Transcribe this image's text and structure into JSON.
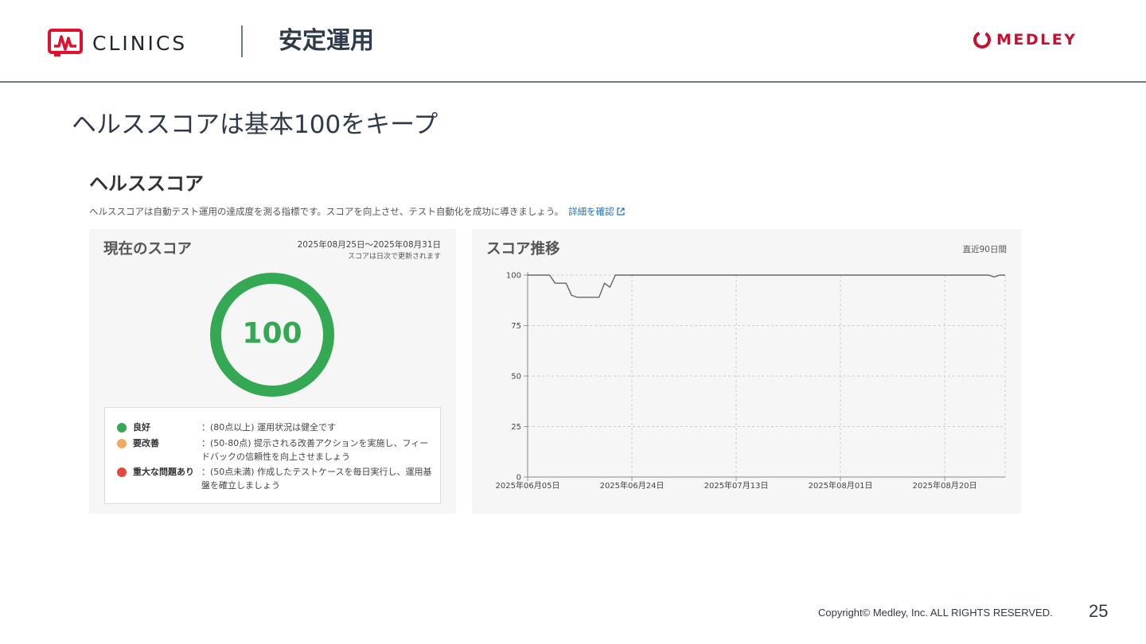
{
  "header": {
    "brand": "CLINICS",
    "section_title": "安定運用",
    "company": "MEDLEY",
    "brand_color": "#e0102e",
    "company_color": "#c8102e"
  },
  "slide": {
    "heading": "ヘルススコアは基本100をキープ"
  },
  "health": {
    "title": "ヘルススコア",
    "description": "ヘルススコアは自動テスト運用の達成度を測る指標です。スコアを向上させ、テスト自動化を成功に導きましょう。",
    "link_label": "詳細を確認",
    "link_icon": "external-link-icon",
    "current": {
      "title": "現在のスコア",
      "period": "2025年08月25日〜2025年08月31日",
      "period_note": "スコアは日次で更新されます",
      "score": "100",
      "score_fraction": 1.0,
      "score_color": "#34a853"
    },
    "legend": [
      {
        "name": "良好",
        "desc": "：(80点以上) 運用状況は健全です",
        "color": "#34a853"
      },
      {
        "name": "要改善",
        "desc": "：(50-80点) 提示される改善アクションを実施し、フィードバックの信頼性を向上させましょう",
        "color": "#f4a860"
      },
      {
        "name": "重大な問題あり",
        "desc": "：(50点未満) 作成したテストケースを毎日実行し、運用基盤を確立しましょう",
        "color": "#e04a3f"
      }
    ],
    "trend": {
      "title": "スコア推移",
      "range_label": "直近90日間"
    }
  },
  "chart_data": {
    "type": "line",
    "title": "スコア推移",
    "xlabel": "",
    "ylabel": "",
    "ylim": [
      0,
      100
    ],
    "yticks": [
      0,
      25,
      50,
      75,
      100
    ],
    "xticks": [
      "2025年06月05日",
      "2025年06月24日",
      "2025年07月13日",
      "2025年08月01日",
      "2025年08月20日"
    ],
    "x_range": [
      "2025-06-05",
      "2025-08-31"
    ],
    "grid": true,
    "series": [
      {
        "color": "#666666",
        "points": [
          [
            "2025-06-05",
            100
          ],
          [
            "2025-06-06",
            100
          ],
          [
            "2025-06-07",
            100
          ],
          [
            "2025-06-08",
            100
          ],
          [
            "2025-06-09",
            100
          ],
          [
            "2025-06-10",
            96
          ],
          [
            "2025-06-11",
            96
          ],
          [
            "2025-06-12",
            96
          ],
          [
            "2025-06-13",
            90
          ],
          [
            "2025-06-14",
            89
          ],
          [
            "2025-06-15",
            89
          ],
          [
            "2025-06-16",
            89
          ],
          [
            "2025-06-17",
            89
          ],
          [
            "2025-06-18",
            89
          ],
          [
            "2025-06-19",
            96
          ],
          [
            "2025-06-20",
            94
          ],
          [
            "2025-06-21",
            100
          ],
          [
            "2025-06-22",
            100
          ],
          [
            "2025-06-24",
            100
          ],
          [
            "2025-07-13",
            100
          ],
          [
            "2025-08-01",
            100
          ],
          [
            "2025-08-20",
            100
          ],
          [
            "2025-08-28",
            100
          ],
          [
            "2025-08-29",
            99
          ],
          [
            "2025-08-30",
            100
          ],
          [
            "2025-08-31",
            100
          ]
        ]
      }
    ]
  },
  "footer": {
    "copyright": "Copyright© Medley, Inc. ALL RIGHTS RESERVED.",
    "page_number": "25"
  }
}
